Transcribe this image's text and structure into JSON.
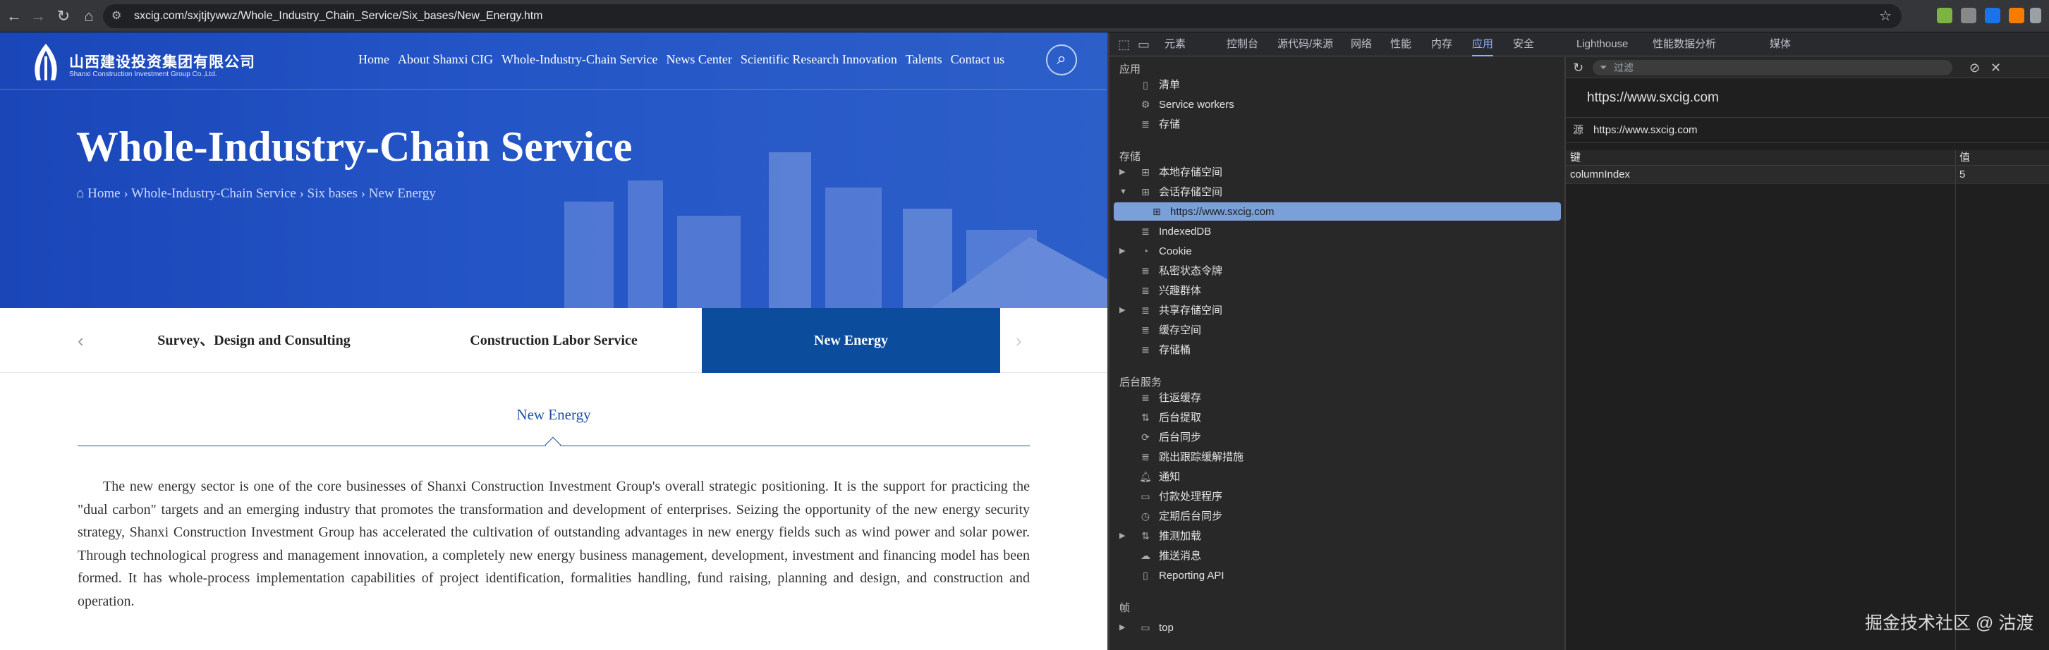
{
  "browser": {
    "url": "sxcig.com/sxjtjtywwz/Whole_Industry_Chain_Service/Six_bases/New_Energy.htm",
    "nav_icons": [
      "back-icon",
      "forward-icon",
      "reload-icon",
      "home-icon"
    ]
  },
  "site": {
    "logo_cn": "山西建设投资集团有限公司",
    "logo_en": "Shanxi Construction Investment Group Co.,Ltd.",
    "nav": [
      "Home",
      "About Shanxi CIG",
      "Whole-Industry-Chain Service",
      "News Center",
      "Scientific Research Innovation",
      "Talents",
      "Contact us"
    ],
    "hero_title": "Whole-Industry-Chain Service",
    "breadcrumb": [
      "Home",
      "Whole-Industry-Chain Service",
      "Six bases",
      "New Energy"
    ],
    "breadcrumb_sep": "›",
    "tabs": [
      "Survey、Design and Consulting",
      "Construction Labor Service",
      "New Energy"
    ],
    "active_tab": "New Energy",
    "content_title": "New Energy",
    "content_body": "The new energy sector is one of the core businesses of Shanxi Construction Investment Group's overall strategic positioning. It is the support for practicing the \"dual carbon\" targets and an emerging industry that promotes the transformation and development of enterprises. Seizing the opportunity of the new energy security strategy, Shanxi Construction Investment Group has accelerated the cultivation of outstanding advantages in new energy fields such as wind power and solar power. Through technological progress and management innovation, a completely new energy business management, development, investment and financing model has been formed. It has whole-process implementation capabilities of project identification, formalities handling, fund raising, planning and design, and construction and operation.",
    "colors": {
      "hero": "#2455c6",
      "active_tab": "#0b4c9c",
      "accent": "#1f4fa3"
    }
  },
  "devtools": {
    "tabs": [
      "元素",
      "控制台",
      "源代码/来源",
      "网络",
      "性能",
      "内存",
      "应用",
      "安全",
      "Lighthouse",
      "性能数据分析",
      "媒体"
    ],
    "selected_tab": "应用",
    "sections": {
      "app": "应用",
      "storage": "存储",
      "background": "后台服务",
      "frames": "帧"
    },
    "app_items": [
      "清单",
      "Service workers",
      "存储"
    ],
    "storage_items": [
      "本地存储空间",
      "会话存储空间",
      "https://www.sxcig.com",
      "IndexedDB",
      "Cookie",
      "私密状态令牌",
      "兴趣群体",
      "共享存储空间",
      "缓存空间",
      "存储桶"
    ],
    "background_items": [
      "往返缓存",
      "后台提取",
      "后台同步",
      "跳出跟踪缓解措施",
      "通知",
      "付款处理程序",
      "定期后台同步",
      "推测加载",
      "推送消息",
      "Reporting API"
    ],
    "frame_items": [
      "top"
    ],
    "filter_placeholder": "过滤",
    "origin_heading": "https://www.sxcig.com",
    "origin_label": "源",
    "origin_value": "https://www.sxcig.com",
    "table_headers": [
      "键",
      "值"
    ],
    "table_rows": [
      {
        "key": "columnIndex",
        "value": "5"
      }
    ]
  },
  "watermark": "掘金技术社区 @ 沽渡"
}
